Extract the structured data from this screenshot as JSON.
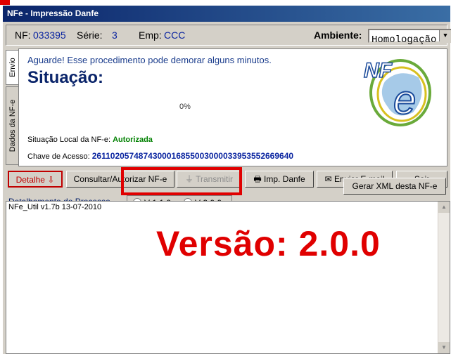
{
  "window": {
    "title": "NFe - Impressão Danfe"
  },
  "header": {
    "nf_label": "NF:",
    "nf_value": "033395",
    "serie_label": "Série:",
    "serie_value": "3",
    "emp_label": "Emp:",
    "emp_value": "CCC",
    "ambiente_label": "Ambiente:",
    "ambiente_value": "Homologação"
  },
  "tabs": [
    {
      "label": "Envio"
    },
    {
      "label": "Dados da NF-e"
    }
  ],
  "status": {
    "message": "Aguarde! Esse procedimento pode demorar alguns minutos.",
    "heading": "Situação:",
    "progress_text": "0%",
    "progress": 0,
    "situacao_local_label": "Situação Local da NF-e:",
    "situacao_local_value": "Autorizada",
    "chave_label": "Chave de Acesso:",
    "chave_value": "26110205748743000168550030000339535526696 40"
  },
  "logo": {
    "text": "NF",
    "accent_text": "e"
  },
  "toolbar": {
    "detalhe": "Detalhe",
    "consultar": "Consultar/Autorizar NF-e",
    "transmitir": "Transmitir",
    "imp_danfe": "Imp. Danfe",
    "enviar_email": "Enviar E-mail",
    "sair": "Sair"
  },
  "detalhamento": {
    "label": "Detalhamento do Processo",
    "option_1": "V 1.1.0",
    "option_2": "V 2.0.0",
    "selected": "V 1.1.0",
    "gerar_xml": "Gerar XML desta NF-e"
  },
  "log": {
    "text": "NFe_Util v1.7b 13-07-2010"
  },
  "annotation": {
    "text": "Versão: 2.0.0"
  },
  "colors": {
    "title_bar": "#0a246a",
    "accent_red": "#e00000",
    "status_green": "#008000",
    "value_blue": "#0a24a0"
  }
}
